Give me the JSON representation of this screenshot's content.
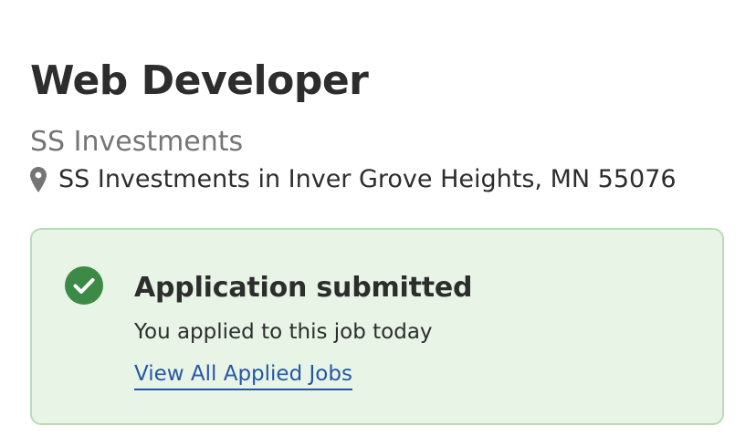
{
  "job": {
    "title": "Web Developer",
    "company": "SS Investments",
    "location": "SS Investments in Inver Grove Heights, MN 55076",
    "location_icon": "map-pin-icon"
  },
  "application_status": {
    "icon": "check-circle-icon",
    "title": "Application submitted",
    "description": "You applied to this job today",
    "link_label": "View All Applied Jobs"
  },
  "colors": {
    "success_green": "#3d8a46",
    "card_background": "#e7f4e6",
    "card_border": "#b8dcb5",
    "link_blue": "#2557a7",
    "muted_text": "#757575"
  }
}
